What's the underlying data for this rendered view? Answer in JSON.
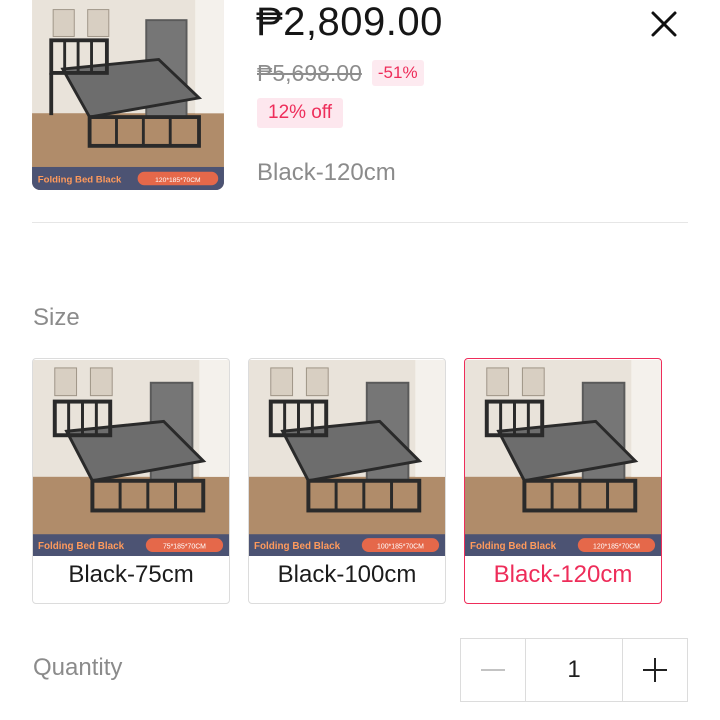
{
  "product": {
    "price": "₱2,809.00",
    "original_price": "₱5,698.00",
    "discount_badge": "-51%",
    "coupon_badge": "12% off",
    "selected_variant": "Black-120cm",
    "image_brand_text": "Folding Bed Black",
    "image_dims_text": "120*185*70CM"
  },
  "header": {
    "close_icon": "close-icon"
  },
  "size_section": {
    "label": "Size",
    "options": [
      {
        "label": "Black-75cm",
        "image_brand_text": "Folding Bed Black",
        "image_dims_text": "75*185*70CM",
        "selected": false
      },
      {
        "label": "Black-100cm",
        "image_brand_text": "Folding Bed Black",
        "image_dims_text": "100*185*70CM",
        "selected": false
      },
      {
        "label": "Black-120cm",
        "image_brand_text": "Folding Bed Black",
        "image_dims_text": "120*185*70CM",
        "selected": true
      }
    ]
  },
  "quantity_section": {
    "label": "Quantity",
    "value": "1",
    "minus_icon": "minus-icon",
    "plus_icon": "plus-icon"
  },
  "colors": {
    "accent": "#ee2d5a",
    "muted_text": "#8b8b8b",
    "border": "#dcdcdc"
  }
}
